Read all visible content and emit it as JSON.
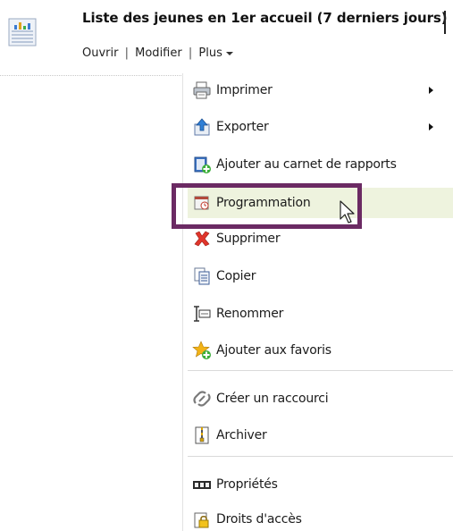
{
  "header": {
    "title": "Liste des jeunes en 1er accueil (7 derniers jours)",
    "report_icon": "report-chart-icon"
  },
  "actions": {
    "open_label": "Ouvrir",
    "separator": "|",
    "edit_label": "Modifier",
    "more_label": "Plus"
  },
  "menu": {
    "items": [
      {
        "label": "Imprimer",
        "icon": "printer-icon",
        "submenu": true
      },
      {
        "label": "Exporter",
        "icon": "export-icon",
        "submenu": true
      },
      {
        "label": "Ajouter au carnet de rapports",
        "icon": "add-report-book-icon",
        "submenu": false
      },
      {
        "label": "Programmation",
        "icon": "schedule-icon",
        "submenu": false,
        "highlighted": true
      },
      {
        "label": "Supprimer",
        "icon": "delete-icon",
        "submenu": false
      },
      {
        "label": "Copier",
        "icon": "copy-icon",
        "submenu": false
      },
      {
        "label": "Renommer",
        "icon": "rename-icon",
        "submenu": false
      },
      {
        "label": "Ajouter aux favoris",
        "icon": "add-favorite-icon",
        "submenu": false
      },
      {
        "label": "Créer un raccourci",
        "icon": "shortcut-icon",
        "submenu": false
      },
      {
        "label": "Archiver",
        "icon": "archive-icon",
        "submenu": false
      },
      {
        "label": "Propriétés",
        "icon": "properties-icon",
        "submenu": false
      },
      {
        "label": "Droits d'accès",
        "icon": "access-rights-icon",
        "submenu": false
      }
    ]
  },
  "colors": {
    "highlight_border": "#6b2a63",
    "hover_row": "#eef3de"
  }
}
